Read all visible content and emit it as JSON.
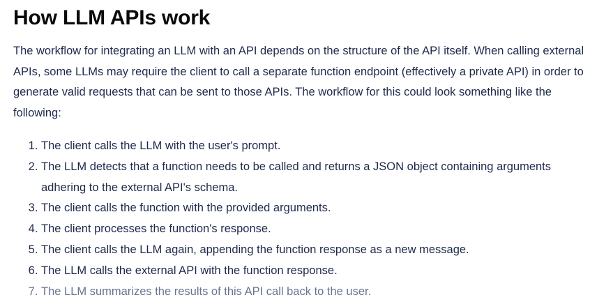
{
  "article": {
    "heading": "How LLM APIs work",
    "intro": "The workflow for integrating an LLM with an API depends on the structure of the API itself. When calling external APIs, some LLMs may require the client to call a separate function endpoint (effectively a private API) in order to generate valid requests that can be sent to those APIs. The workflow for this could look something like the following:",
    "steps": [
      "The client calls the LLM with the user's prompt.",
      "The LLM detects that a function needs to be called and returns a JSON object containing arguments adhering to the external API's schema.",
      "The client calls the function with the provided arguments.",
      "The client processes the function's response.",
      "The client calls the LLM again, appending the function response as a new message.",
      "The LLM calls the external API with the function response.",
      "The LLM summarizes the results of this API call back to the user."
    ]
  },
  "colors": {
    "heading": "#0a0a0a",
    "body_text": "#1f2a4b",
    "faded_text": "#6b7391",
    "background": "#ffffff"
  }
}
